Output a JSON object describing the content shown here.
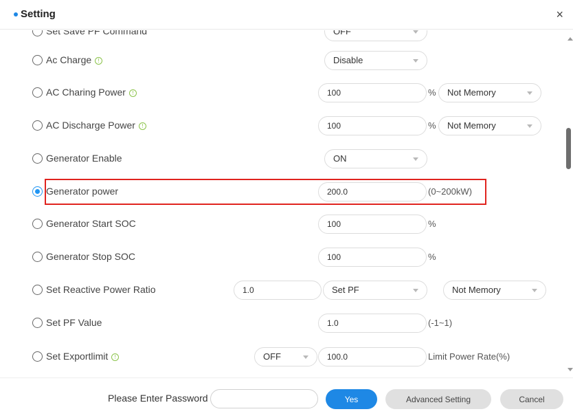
{
  "header": {
    "title": "Setting",
    "close": "×"
  },
  "rows": [
    {
      "label": "Set Save PF Command",
      "value": "OFF"
    },
    {
      "label": "Ac Charge",
      "info": "!",
      "value": "Disable"
    },
    {
      "label": "AC Charing Power",
      "info": "!",
      "value": "100",
      "unit": "%",
      "memory": "Not Memory"
    },
    {
      "label": "AC Discharge Power",
      "info": "!",
      "value": "100",
      "unit": "%",
      "memory": "Not Memory"
    },
    {
      "label": "Generator Enable",
      "value": "ON"
    },
    {
      "label": "Generator power",
      "value": "200.0",
      "unit": "(0~200kW)"
    },
    {
      "label": "Generator Start SOC",
      "value": "100",
      "unit": "%"
    },
    {
      "label": "Generator Stop SOC",
      "value": "100",
      "unit": "%"
    },
    {
      "label": "Set Reactive Power Ratio",
      "value": "1.0",
      "mode": "Set PF",
      "memory": "Not Memory"
    },
    {
      "label": "Set PF Value",
      "value": "1.0",
      "unit": "(-1~1)"
    },
    {
      "label": "Set Exportlimit",
      "info": "!",
      "switch": "OFF",
      "value": "100.0",
      "unit": "Limit Power Rate(%)"
    }
  ],
  "footer": {
    "password_label": "Please Enter Password",
    "password_value": "",
    "yes_label": "Yes",
    "advanced_label": "Advanced Setting",
    "cancel_label": "Cancel"
  },
  "colors": {
    "accent": "#1e88e5",
    "highlight_border": "#e0231e",
    "info_icon": "#8bc34a"
  }
}
